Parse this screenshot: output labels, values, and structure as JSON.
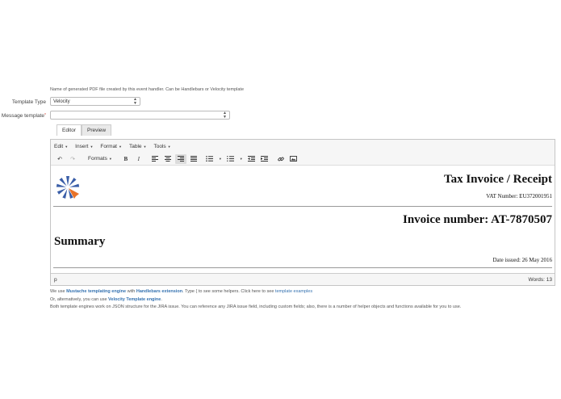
{
  "filename_hint": "Name of generated PDF file created by this event handler. Can be Handlebars or Velocity template",
  "template_type": {
    "label": "Template Type",
    "value": "Velocity"
  },
  "message_template": {
    "label": "Message template",
    "required_mark": "*",
    "value": ""
  },
  "tabs": [
    {
      "label": "Editor",
      "active": true
    },
    {
      "label": "Preview",
      "active": false
    }
  ],
  "menubar": [
    {
      "label": "Edit"
    },
    {
      "label": "Insert"
    },
    {
      "label": "Format"
    },
    {
      "label": "Table"
    },
    {
      "label": "Tools"
    }
  ],
  "toolbar": {
    "undo_icon": "↶",
    "redo_icon": "↷",
    "formats_label": "Formats",
    "bold": "B",
    "italic": "I"
  },
  "document": {
    "title": "Tax Invoice / Receipt",
    "vat": "VAT Number: EU372001951",
    "invoice_number": "Invoice number: AT-7870507",
    "summary": "Summary",
    "date_issued": "Date issued: 26 May 2016"
  },
  "statusbar": {
    "path": "p",
    "words": "Words: 13"
  },
  "footer": {
    "line1_a": "We use ",
    "line1_link1": "Mustache templating engine",
    "line1_b": " with ",
    "line1_link2": "Handlebars extension",
    "line1_c": ". Type { to see some helpers. Click here to see ",
    "line1_link3": "template examples",
    "line2_a": "Or, alternatively, you can use ",
    "line2_link": "Velocity Template engine",
    "line2_b": ".",
    "line3": "Both template engines work on JSON structure for the JIRA issue. You can reference any JIRA issue field, including custom fields; also, there is a number of helper objects and functions available for you to use."
  }
}
